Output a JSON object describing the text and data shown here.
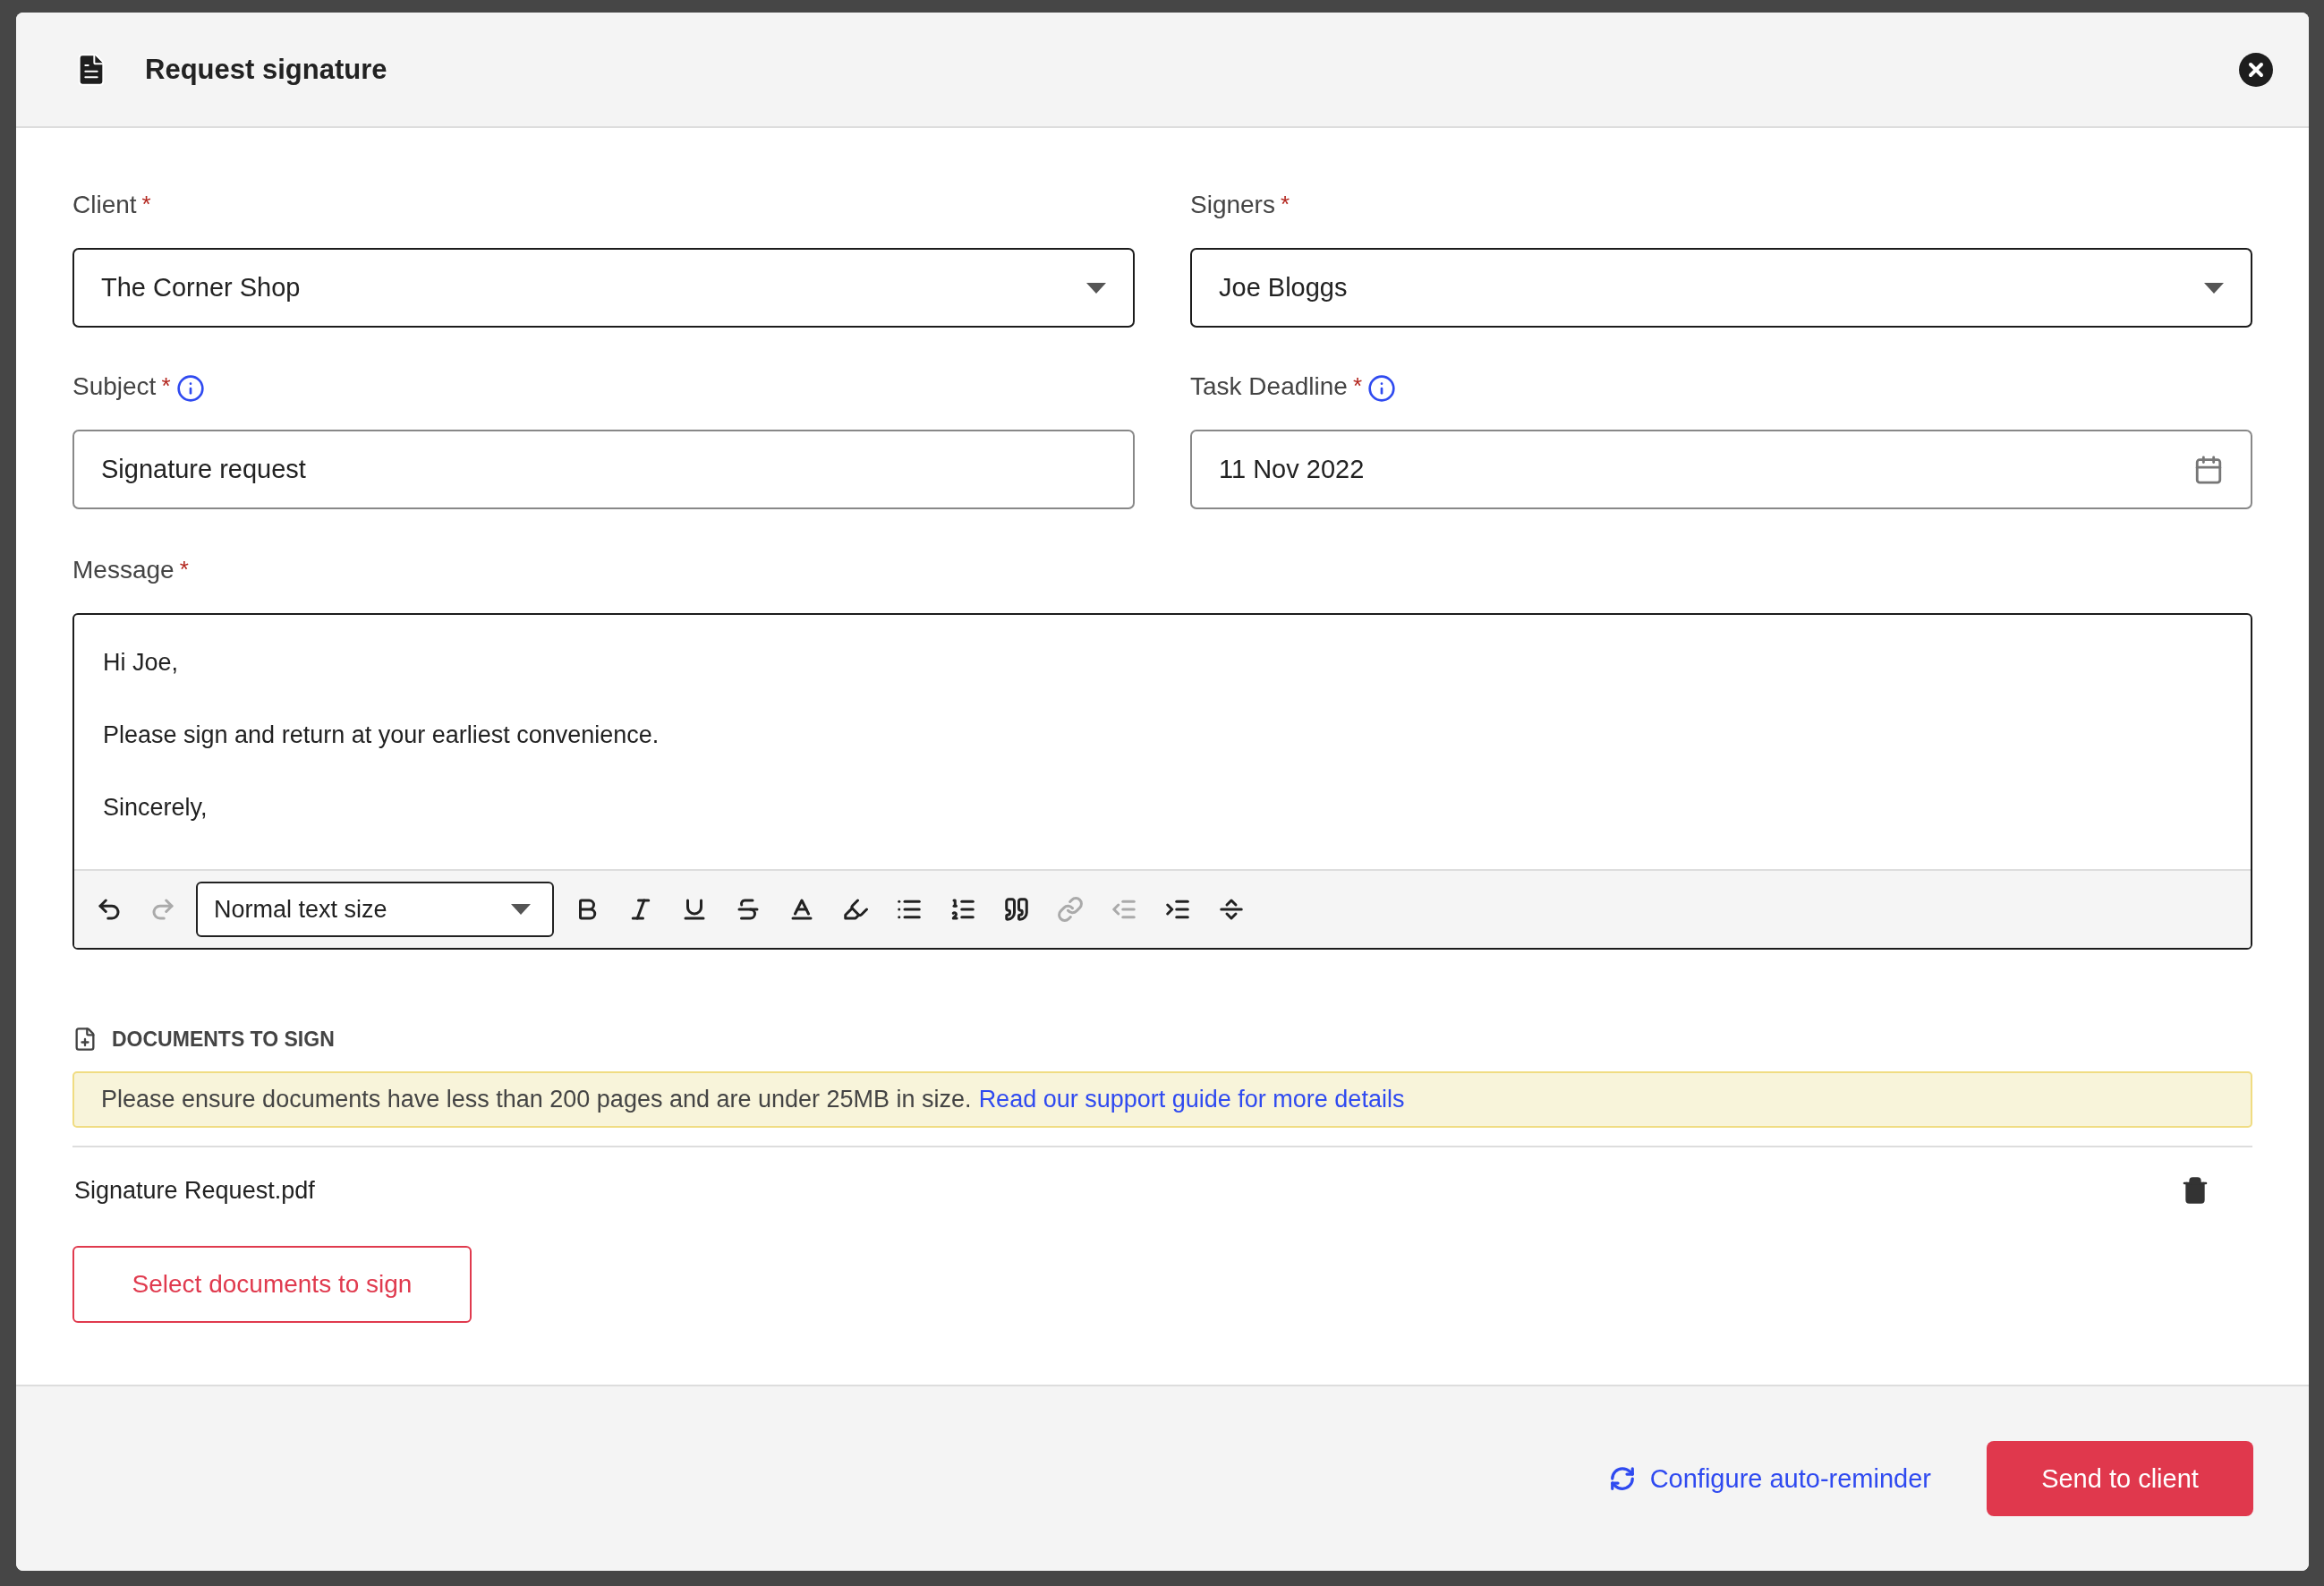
{
  "dialog": {
    "title": "Request signature"
  },
  "fields": [
    {
      "kind": "select",
      "label": "Client",
      "required_mark": "*",
      "info": false,
      "value": "The Corner Shop"
    },
    {
      "kind": "select",
      "label": "Signers",
      "required_mark": "*",
      "info": false,
      "value": "Joe Bloggs"
    },
    {
      "kind": "text",
      "label": "Subject",
      "required_mark": "*",
      "info": true,
      "value": "Signature request"
    },
    {
      "kind": "date",
      "label": "Task Deadline",
      "required_mark": "*",
      "info": true,
      "value": "11 Nov 2022"
    }
  ],
  "message": {
    "label": "Message",
    "required_mark": "*",
    "paragraphs": [
      "Hi Joe,",
      "Please sign and return at your earliest convenience.",
      "Sincerely,"
    ],
    "toolbar": [
      {
        "kind": "undo",
        "disabled": false
      },
      {
        "kind": "redo",
        "disabled": true
      },
      {
        "kind": "select",
        "value": "Normal text size",
        "disabled": false
      },
      {
        "kind": "bold",
        "disabled": false
      },
      {
        "kind": "italic",
        "disabled": false
      },
      {
        "kind": "underline",
        "disabled": false
      },
      {
        "kind": "strike",
        "disabled": false
      },
      {
        "kind": "color",
        "disabled": false
      },
      {
        "kind": "highlight",
        "disabled": false
      },
      {
        "kind": "bullets",
        "disabled": false
      },
      {
        "kind": "numbers",
        "disabled": false
      },
      {
        "kind": "quote",
        "disabled": false
      },
      {
        "kind": "link",
        "disabled": true
      },
      {
        "kind": "outdent",
        "disabled": true
      },
      {
        "kind": "indent",
        "disabled": false
      },
      {
        "kind": "divider",
        "disabled": false
      }
    ]
  },
  "documents": {
    "heading": "DOCUMENTS TO SIGN",
    "notice": {
      "text": "Please ensure documents have less than 200 pages and are under 25MB in size.",
      "link": "Read our support guide for more details"
    },
    "files": [
      {
        "name": "Signature Request.pdf"
      }
    ],
    "select_button": "Select documents to sign"
  },
  "footer": {
    "reminder_link": "Configure auto-reminder",
    "send_button": "Send to client"
  }
}
